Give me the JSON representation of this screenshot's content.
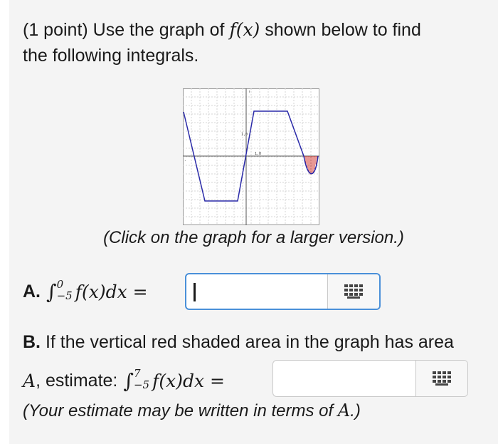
{
  "intro": {
    "line1_prefix": "(1 point) Use the graph of",
    "func": "f(x)",
    "line1_suffix": "shown below to find",
    "line2": "the following integrals."
  },
  "graph": {
    "tick_labels": [
      "1,0",
      "1,0"
    ],
    "accent_line": "#2a2aa8",
    "shade_color": "#d0302a"
  },
  "caption": "(Click on the graph for a larger version.)",
  "part_a": {
    "label": "A.",
    "integral_sign": "∫",
    "upper": "0",
    "lower": "−5",
    "integrand": "f(x)dx =",
    "answer_value": "",
    "keyboard_icon": "keypad-icon"
  },
  "part_b": {
    "label": "B.",
    "text1": "If the vertical red shaded area in the graph has area",
    "var": "A",
    "text2": ", estimate:",
    "integral_sign": "∫",
    "upper": "7",
    "lower": "−5",
    "integrand": "f(x)dx =",
    "answer_value": "",
    "note_prefix": "(Your estimate may be written in terms of",
    "note_var": "A",
    "note_suffix": ".)"
  }
}
